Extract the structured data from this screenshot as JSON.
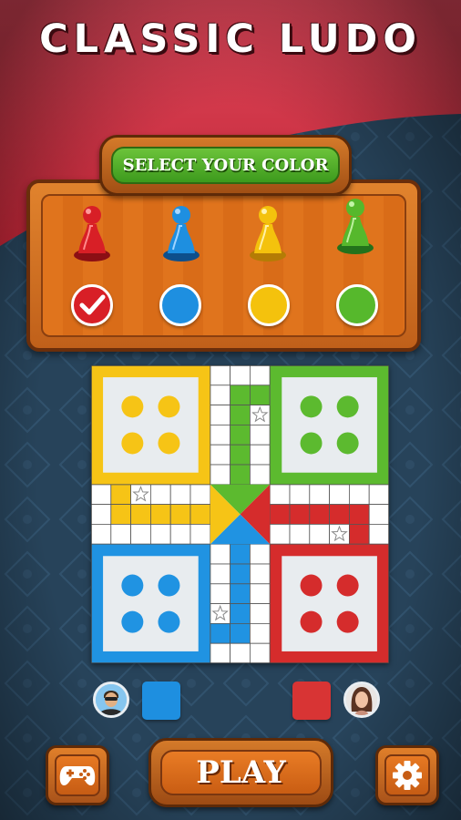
{
  "app": {
    "title": "CLASSIC LUDO"
  },
  "color_select": {
    "banner_label": "SELECT YOUR COLOR",
    "options": [
      {
        "color": "red",
        "hex": "#d81f26",
        "selected": true,
        "pawn_icon": "red-pawn-icon"
      },
      {
        "color": "blue",
        "hex": "#1e8fe0",
        "selected": false,
        "pawn_icon": "blue-pawn-icon"
      },
      {
        "color": "yellow",
        "hex": "#f4c20d",
        "selected": false,
        "pawn_icon": "yellow-pawn-icon"
      },
      {
        "color": "green",
        "hex": "#56b82c",
        "selected": false,
        "pawn_icon": "green-pawn-icon"
      }
    ]
  },
  "board": {
    "homes": {
      "top_left": "yellow",
      "top_right": "green",
      "bottom_left": "blue",
      "bottom_right": "red"
    },
    "colors": {
      "yellow": "#f6c416",
      "green": "#5cba2f",
      "blue": "#2093e2",
      "red": "#d52c2c"
    }
  },
  "players": {
    "left": {
      "avatar": "male-avatar",
      "color": "#1e8fe0"
    },
    "right": {
      "avatar": "female-avatar",
      "color": "#d83434"
    }
  },
  "footer": {
    "play_label": "PLAY",
    "left_icon": "gamepad-icon",
    "right_icon": "gear-icon"
  },
  "theme": {
    "background": "#27435a",
    "title_band": "#d83a48",
    "wood": "#d96c18"
  }
}
